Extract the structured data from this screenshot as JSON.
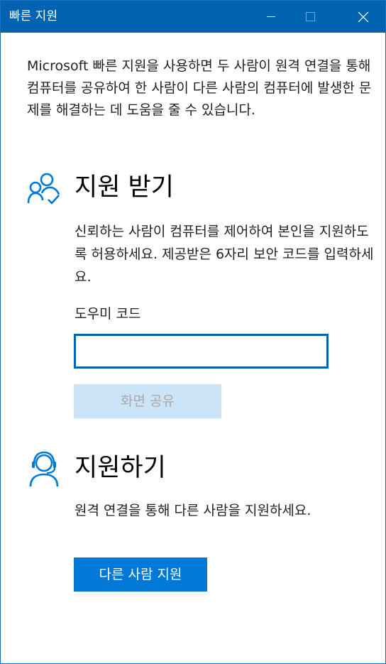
{
  "window": {
    "title": "빠른 지원"
  },
  "intro": {
    "text": "Microsoft 빠른 지원을 사용하면 두 사람이 원격 연결을 통해 컴퓨터를 공유하여 한 사람이 다른 사람의 컴퓨터에 발생한 문제를 해결하는 데 도움을 줄 수 있습니다."
  },
  "get_help": {
    "heading": "지원 받기",
    "description": "신뢰하는 사람이 컴퓨터를 제어하여 본인을 지원하도록 허용하세요. 제공받은 6자리 보안 코드를 입력하세요.",
    "code_label": "도우미 코드",
    "code_value": "",
    "share_button": "화면 공유",
    "icon": "people-check-icon"
  },
  "give_help": {
    "heading": "지원하기",
    "description": "원격 연결을 통해 다른 사람을 지원하세요.",
    "help_button": "다른 사람 지원",
    "icon": "headset-person-icon"
  },
  "colors": {
    "titlebar": "#0063b1",
    "accent": "#0078d7",
    "disabled_button": "#cce4f7",
    "icon": "#0078d7"
  }
}
